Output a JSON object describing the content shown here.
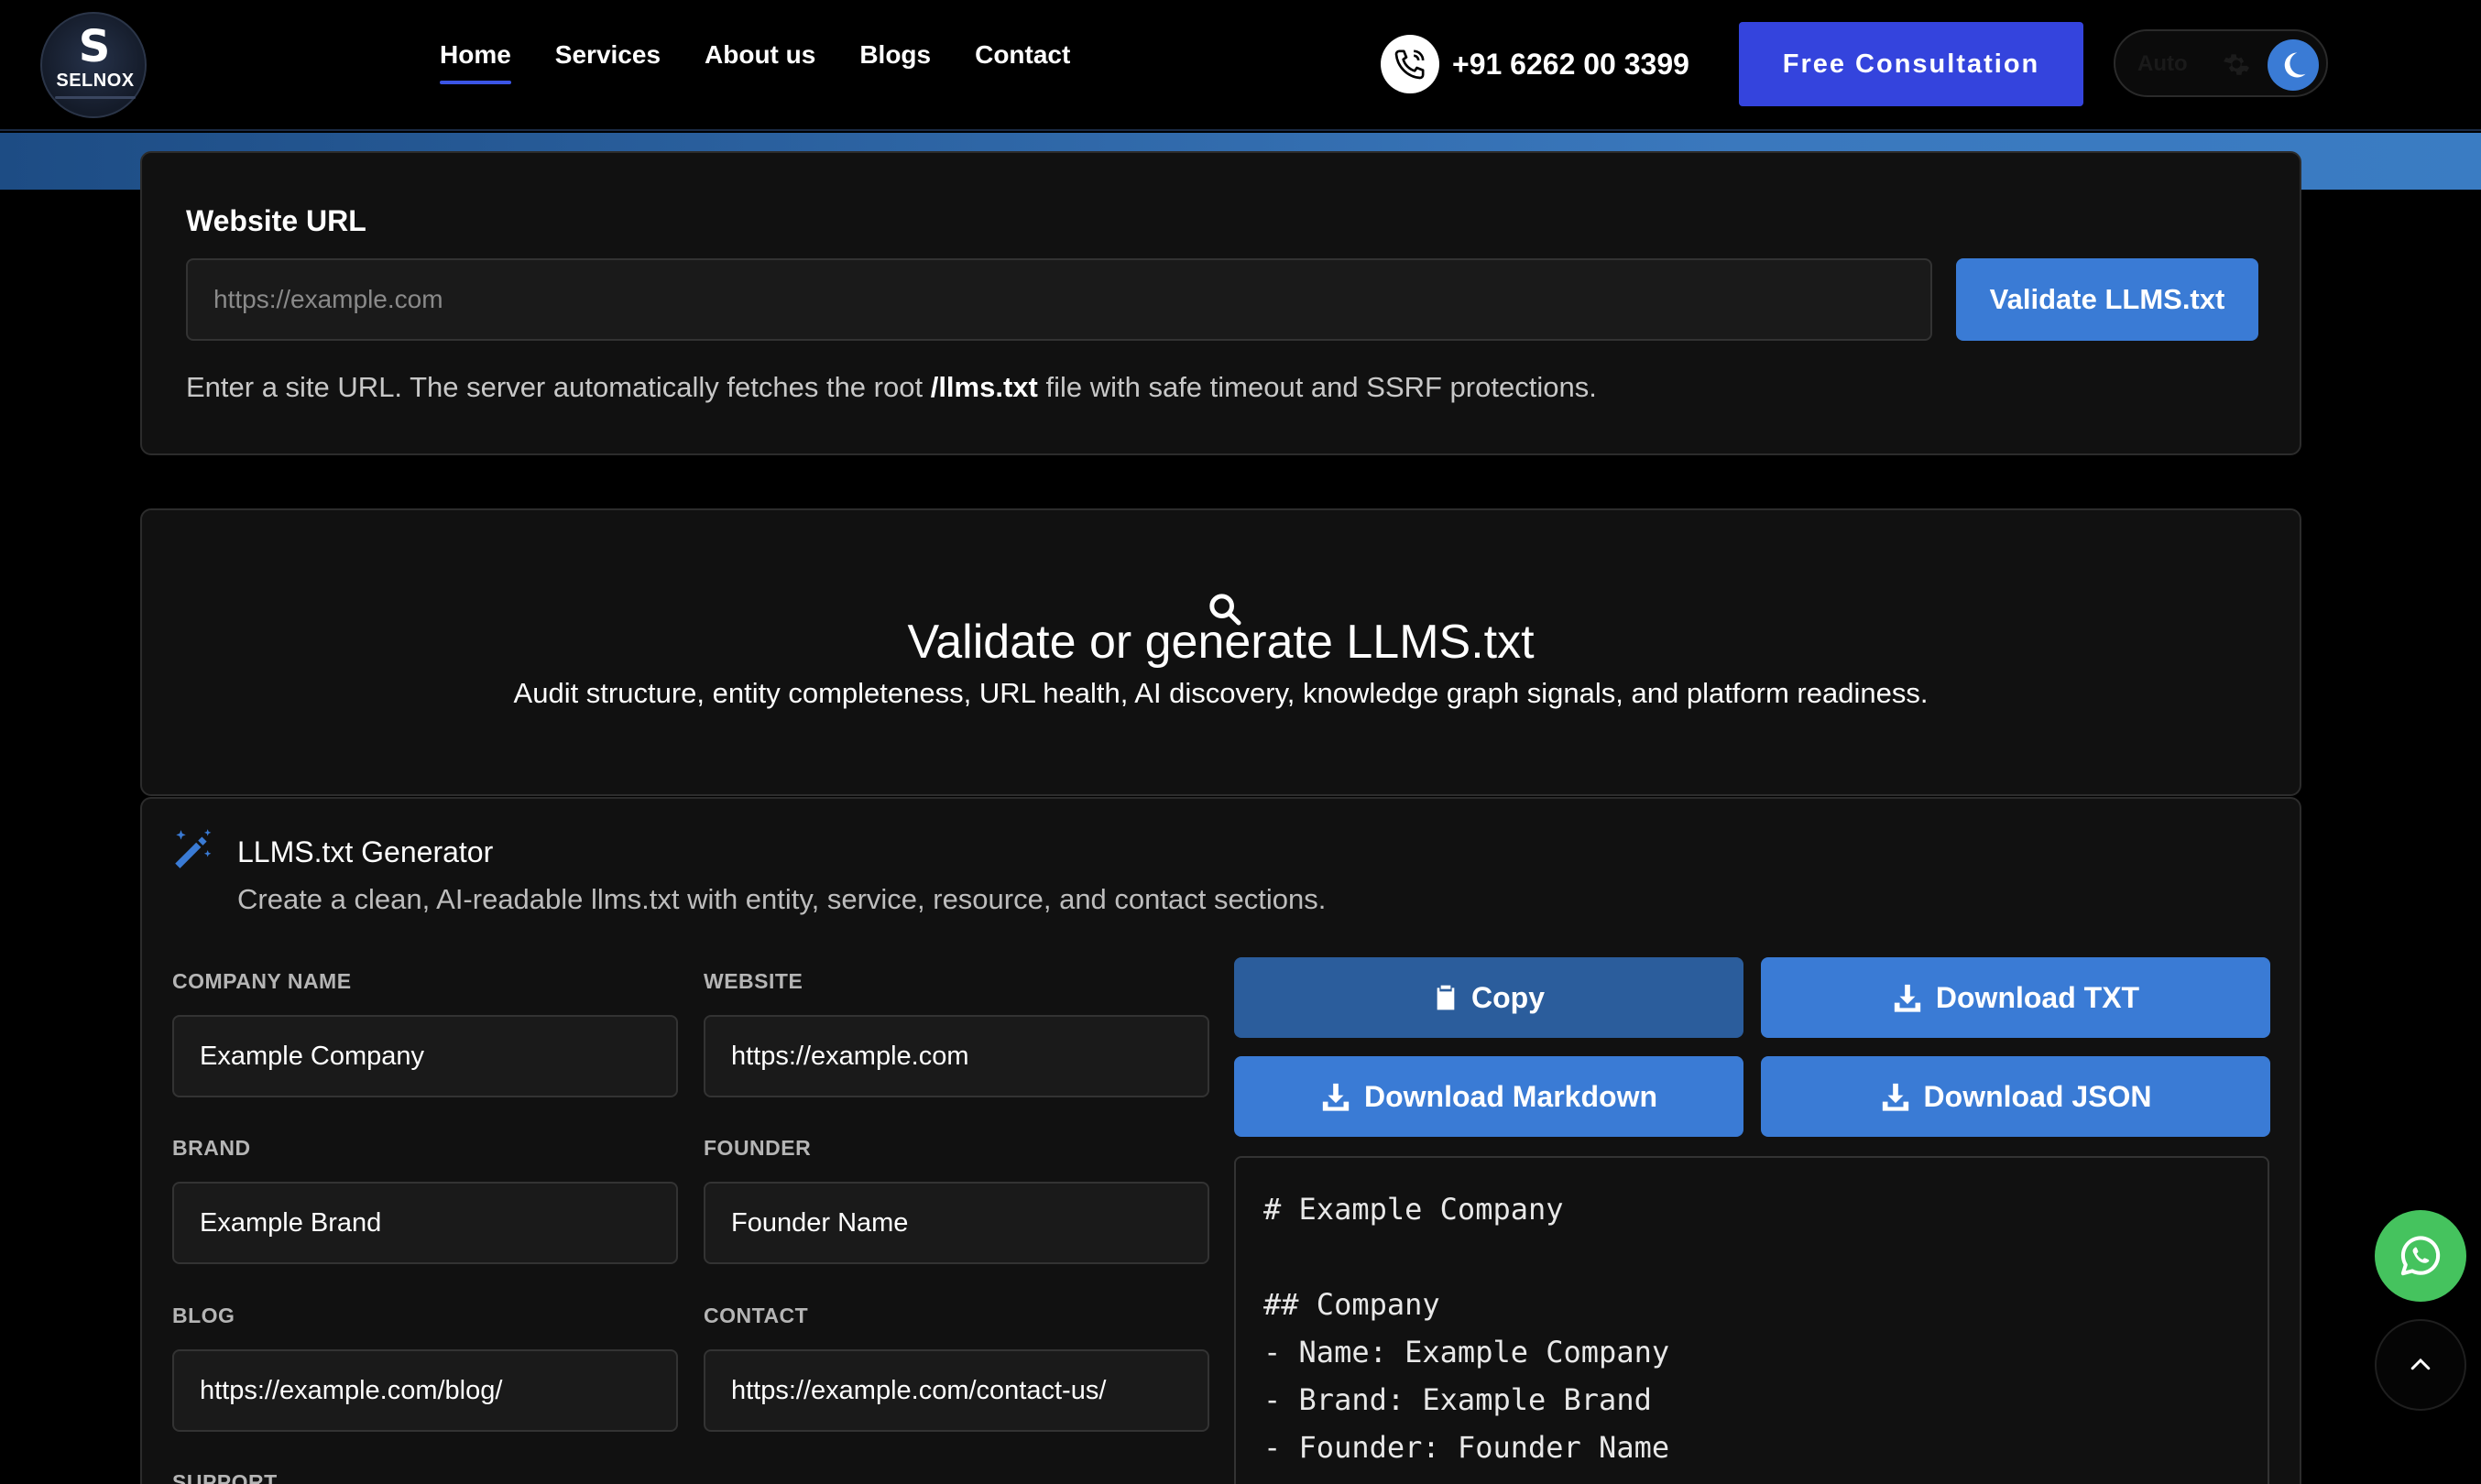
{
  "header": {
    "logo_text": "SELNOX",
    "nav": [
      {
        "label": "Home",
        "active": true
      },
      {
        "label": "Services",
        "active": false
      },
      {
        "label": "About us",
        "active": false
      },
      {
        "label": "Blogs",
        "active": false
      },
      {
        "label": "Contact",
        "active": false
      }
    ],
    "phone": "+91 6262 00 3399",
    "cta_label": "Free Consultation",
    "theme": {
      "label": "Auto",
      "mode": "dark"
    }
  },
  "url_card": {
    "label": "Website URL",
    "input_placeholder": "https://example.com",
    "input_value": "",
    "button_label": "Validate LLMS.txt",
    "help_prefix": "Enter a site URL. The server automatically fetches the root ",
    "help_bold": "/llms.txt",
    "help_suffix": " file with safe timeout and SSRF protections."
  },
  "hero": {
    "title": "Validate or generate LLMS.txt",
    "subtitle": "Audit structure, entity completeness, URL health, AI discovery, knowledge graph signals, and platform readiness."
  },
  "generator": {
    "title": "LLMS.txt Generator",
    "subtitle": "Create a clean, AI-readable llms.txt with entity, service, resource, and contact sections.",
    "fields": {
      "company_name": {
        "label": "COMPANY NAME",
        "value": "Example Company"
      },
      "website": {
        "label": "WEBSITE",
        "value": "https://example.com"
      },
      "brand": {
        "label": "BRAND",
        "value": "Example Brand"
      },
      "founder": {
        "label": "FOUNDER",
        "value": "Founder Name"
      },
      "blog": {
        "label": "BLOG",
        "value": "https://example.com/blog/"
      },
      "contact": {
        "label": "CONTACT",
        "value": "https://example.com/contact-us/"
      },
      "support": {
        "label": "SUPPORT"
      }
    },
    "actions": {
      "copy": "Copy",
      "download_txt": "Download TXT",
      "download_markdown": "Download Markdown",
      "download_json": "Download JSON"
    },
    "output_lines": [
      "# Example Company",
      "",
      "## Company",
      "- Name: Example Company",
      "- Brand: Example Brand",
      "- Founder: Founder Name"
    ]
  },
  "colors": {
    "accent": "#3a7bd5",
    "cta": "#3444dd",
    "copy_button": "#2b5d9c",
    "whatsapp": "#45c35e"
  },
  "icons": [
    "phone-icon",
    "gear-icon",
    "moon-icon",
    "search-icon",
    "magic-wand-icon",
    "clipboard-icon",
    "download-icon",
    "whatsapp-icon",
    "chevron-up-icon"
  ]
}
